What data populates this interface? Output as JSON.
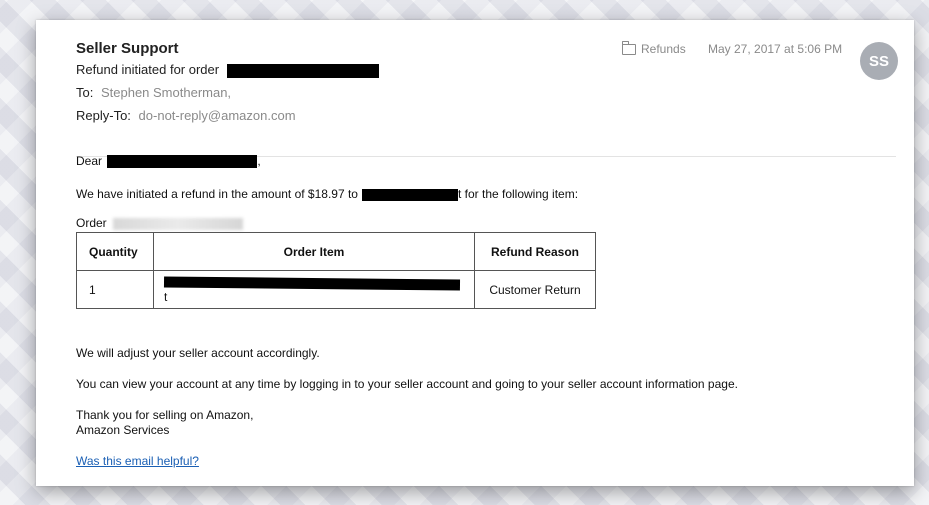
{
  "header": {
    "from": "Seller Support",
    "subject": "Refund initiated for order",
    "to_label": "To:",
    "to_value": "Stephen Smotherman,",
    "reply_label": "Reply-To:",
    "reply_value": "do-not-reply@amazon.com",
    "mailbox": "Refunds",
    "mailbox_icon": "folder-icon",
    "date": "May 27, 2017 at 5:06 PM",
    "avatar_initials": "SS"
  },
  "body": {
    "greeting": "Dear",
    "refund_before": "We have initiated a refund in the amount of $18.97 to",
    "refund_after": "t for the following item:",
    "order_label": "Order",
    "table": {
      "headers": [
        "Quantity",
        "Order Item",
        "Refund Reason"
      ],
      "rows": [
        {
          "quantity": "1",
          "item_tail": "t",
          "reason": "Customer Return"
        }
      ]
    },
    "adjust": "We will adjust your seller account accordingly.",
    "view": "You can view your account at any time by logging in to your seller account and going to your seller account information page.",
    "thanks": "Thank you for selling on Amazon,",
    "signature": "Amazon Services",
    "helpful_link": "Was this email helpful?"
  },
  "colors": {
    "link": "#1a5fb4",
    "muted": "#8a8a8a",
    "avatar_bg": "#a9adb4"
  }
}
